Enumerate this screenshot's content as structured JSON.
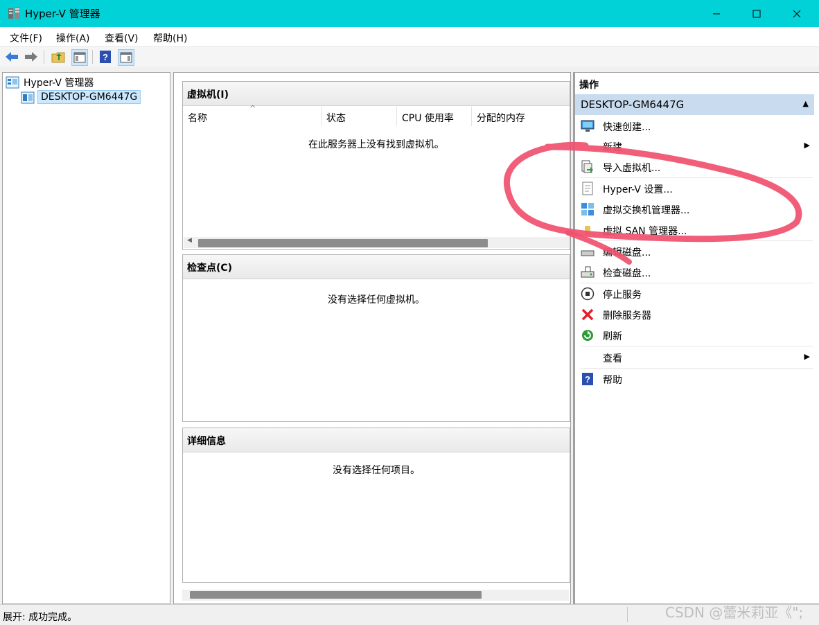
{
  "window": {
    "title": "Hyper-V 管理器"
  },
  "menu": [
    "文件(F)",
    "操作(A)",
    "查看(V)",
    "帮助(H)"
  ],
  "toolbar": [
    "back-arrow-icon",
    "forward-arrow-icon",
    "up-folder-icon",
    "show-hide-tree-icon",
    "help-icon",
    "show-hide-actions-icon"
  ],
  "tree": {
    "root": "Hyper-V 管理器",
    "server": "DESKTOP-GM6447G"
  },
  "vm_panel": {
    "title": "虚拟机(I)",
    "columns": [
      "名称",
      "状态",
      "CPU 使用率",
      "分配的内存"
    ],
    "sort_indicator": "^",
    "empty": "在此服务器上没有找到虚拟机。"
  },
  "checkpoint_panel": {
    "title": "检查点(C)",
    "empty": "没有选择任何虚拟机。"
  },
  "details_panel": {
    "title": "详细信息",
    "empty": "没有选择任何项目。"
  },
  "actions": {
    "title": "操作",
    "group": "DESKTOP-GM6447G",
    "items": [
      {
        "label": "快速创建...",
        "icon": "quick-create-icon"
      },
      {
        "label": "新建",
        "icon": "none",
        "submenu": true
      },
      {
        "label": "导入虚拟机...",
        "icon": "import-vm-icon"
      },
      {
        "label": "Hyper-V 设置...",
        "icon": "settings-document-icon"
      },
      {
        "label": "虚拟交换机管理器...",
        "icon": "virtual-switch-icon"
      },
      {
        "label": "虚拟 SAN 管理器...",
        "icon": "san-icon"
      },
      {
        "label": "编辑磁盘...",
        "icon": "edit-disk-icon"
      },
      {
        "label": "检查磁盘...",
        "icon": "inspect-disk-icon"
      },
      {
        "label": "停止服务",
        "icon": "stop-service-icon"
      },
      {
        "label": "删除服务器",
        "icon": "remove-server-icon"
      },
      {
        "label": "刷新",
        "icon": "refresh-icon"
      },
      {
        "label": "查看",
        "icon": "none",
        "submenu": true
      },
      {
        "label": "帮助",
        "icon": "help-icon"
      }
    ]
  },
  "status": "展开: 成功完成。",
  "watermark": "CSDN @蕾米莉亚《\";",
  "colors": {
    "titlebar": "#00d2d8",
    "selection": "#cce8ff",
    "group_header": "#c9dcef",
    "annotation": "#f0506e"
  }
}
